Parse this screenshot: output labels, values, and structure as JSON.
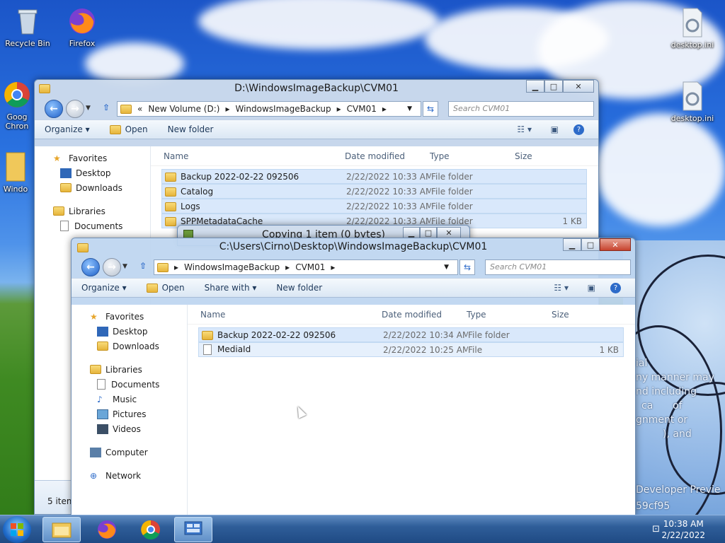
{
  "desktop": {
    "left_icons": [
      {
        "label": "Recycle Bin",
        "icon": "recycle-bin-icon"
      },
      {
        "label": "Firefox",
        "icon": "firefox-icon"
      },
      {
        "label": "Goog Chron",
        "icon": "chrome-icon"
      },
      {
        "label": "Windo",
        "icon": "folder-icon"
      }
    ],
    "right_icons": [
      {
        "label": "desktop.ini",
        "icon": "settings-file-icon"
      },
      {
        "label": "desktop.ini",
        "icon": "settings-file-icon"
      }
    ],
    "wallpaper_text": [
      "ial",
      "ny manner may",
      "nd including",
      "ca",
      "of",
      "gnment or",
      "), and",
      "Developer Previe",
      "59cf95"
    ]
  },
  "back_window": {
    "title": "D:\\WindowsImageBackup\\CVM01",
    "breadcrumb": [
      "«",
      "New Volume (D:)",
      "WindowsImageBackup",
      "CVM01"
    ],
    "search_placeholder": "Search CVM01",
    "toolbar": {
      "organize": "Organize ▾",
      "open": "Open",
      "new_folder": "New folder"
    },
    "nav": {
      "favorites": "Favorites",
      "desktop": "Desktop",
      "downloads": "Downloads",
      "libraries": "Libraries",
      "documents": "Documents"
    },
    "columns": {
      "name": "Name",
      "date": "Date modified",
      "type": "Type",
      "size": "Size"
    },
    "rows": [
      {
        "name": "Backup 2022-02-22 092506",
        "date": "2/22/2022 10:33 AM",
        "type": "File folder",
        "size": ""
      },
      {
        "name": "Catalog",
        "date": "2/22/2022 10:33 AM",
        "type": "File folder",
        "size": ""
      },
      {
        "name": "Logs",
        "date": "2/22/2022 10:33 AM",
        "type": "File folder",
        "size": ""
      },
      {
        "name": "SPPMetadataCache",
        "date": "2/22/2022 10:33 AM",
        "type": "File folder",
        "size": "1 KB"
      }
    ],
    "status": "5 item"
  },
  "copy_dialog": {
    "title": "Copying 1 item (0 bytes)"
  },
  "front_window": {
    "title": "C:\\Users\\Cirno\\Desktop\\WindowsImageBackup\\CVM01",
    "breadcrumb": [
      "WindowsImageBackup",
      "CVM01"
    ],
    "search_placeholder": "Search CVM01",
    "toolbar": {
      "organize": "Organize ▾",
      "open": "Open",
      "share_with": "Share with ▾",
      "new_folder": "New folder"
    },
    "nav": {
      "favorites": "Favorites",
      "desktop": "Desktop",
      "downloads": "Downloads",
      "libraries": "Libraries",
      "documents": "Documents",
      "music": "Music",
      "pictures": "Pictures",
      "videos": "Videos",
      "computer": "Computer",
      "network": "Network"
    },
    "columns": {
      "name": "Name",
      "date": "Date modified",
      "type": "Type",
      "size": "Size"
    },
    "rows": [
      {
        "name": "Backup 2022-02-22 092506",
        "date": "2/22/2022 10:34 AM",
        "type": "File folder",
        "size": ""
      },
      {
        "name": "MediaId",
        "date": "2/22/2022 10:25 AM",
        "type": "File",
        "size": "1 KB"
      }
    ]
  },
  "taskbar": {
    "time": "10:38 AM",
    "date": "2/22/2022"
  }
}
